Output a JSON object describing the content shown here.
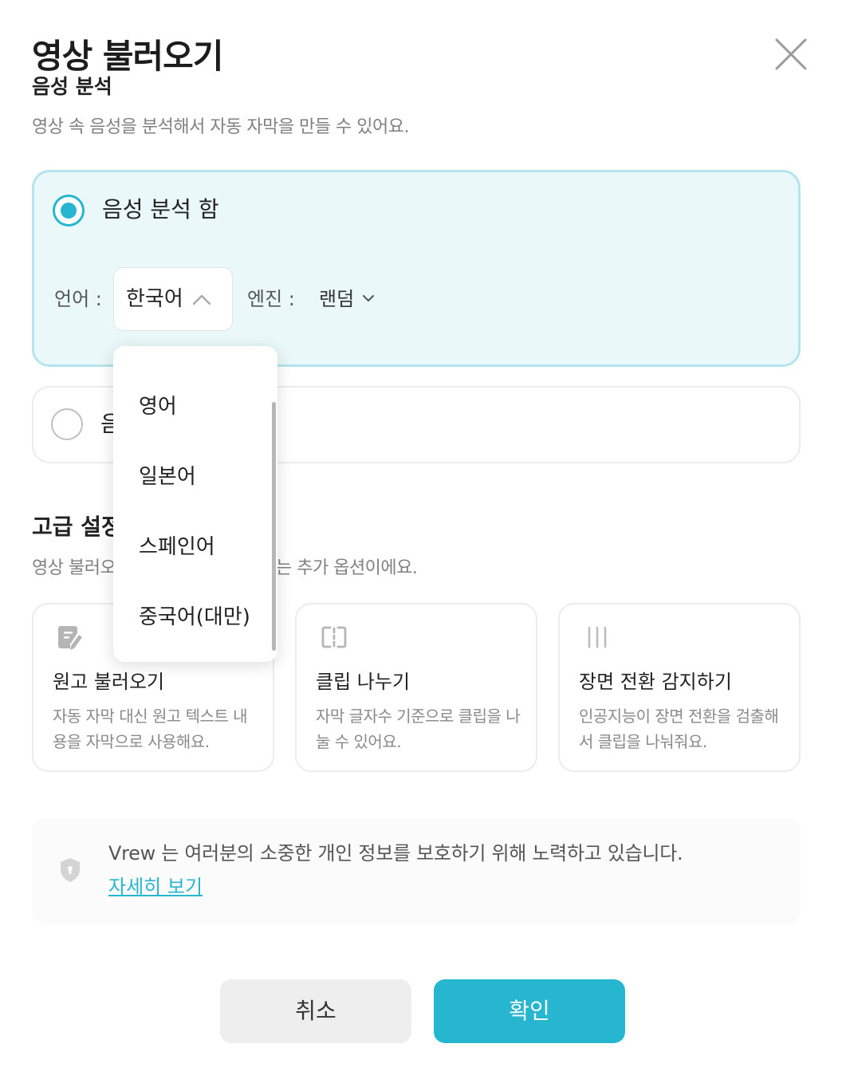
{
  "dialog": {
    "title": "영상 불러오기"
  },
  "speech": {
    "section_title": "음성 분석",
    "description": "영상 속 음성을 분석해서 자동 자막을 만들 수 있어요.",
    "option_on": "음성 분석 함",
    "option_off_partial": "음",
    "language_label": "언어 :",
    "language_value": "한국어",
    "engine_label": "엔진 :",
    "engine_value": "랜덤"
  },
  "language_dropdown": {
    "options": [
      "영어",
      "일본어",
      "스페인어",
      "중국어(대만)"
    ]
  },
  "advanced": {
    "title_partial": "고급 설정",
    "description_left": "영상 불러오",
    "description_right": "는 추가 옵션이에요.",
    "features": [
      {
        "title": "원고 불러오기",
        "desc": "자동 자막 대신 원고 텍스트 내용을 자막으로 사용해요.",
        "icon": "document-pen-icon"
      },
      {
        "title": "클립 나누기",
        "desc": "자막 글자수 기준으로 클립을 나눌 수 있어요.",
        "icon": "split-clip-icon"
      },
      {
        "title": "장면 전환 감지하기",
        "desc": "인공지능이 장면 전환을 검출해서 클립을 나눠줘요.",
        "icon": "scene-lines-icon"
      }
    ]
  },
  "privacy": {
    "text": "Vrew 는 여러분의 소중한 개인 정보를 보호하기 위해 노력하고 있습니다.",
    "link": "자세히 보기"
  },
  "buttons": {
    "cancel": "취소",
    "confirm": "확인"
  },
  "colors": {
    "accent": "#27b6cf",
    "selected_card_bg": "#eaf8fa",
    "selected_card_border": "#b5e5ec"
  }
}
